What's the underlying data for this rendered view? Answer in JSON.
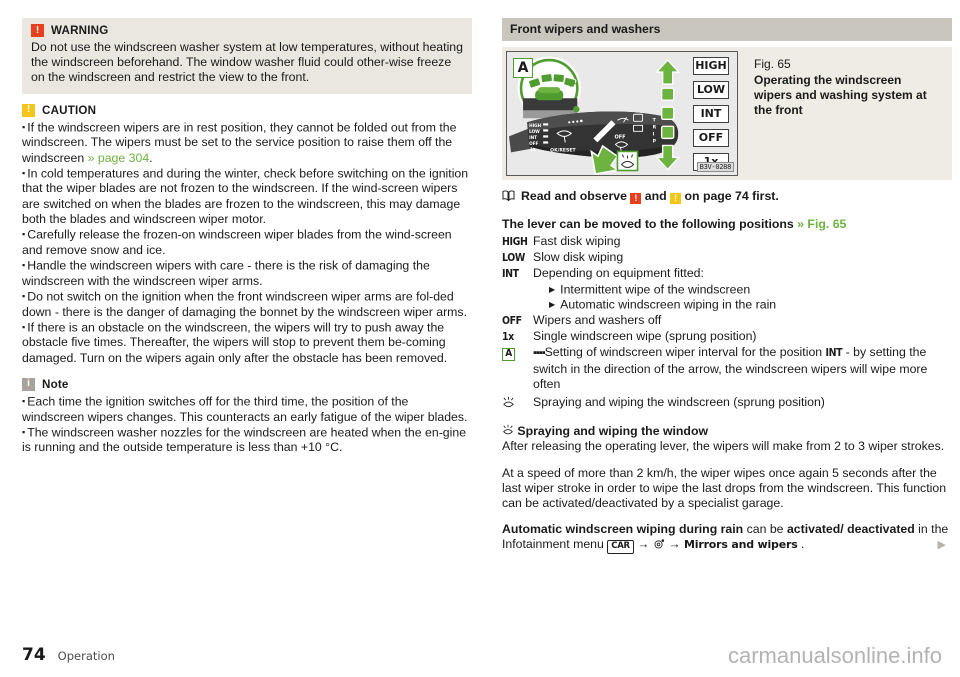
{
  "left": {
    "warning": {
      "badge": "!",
      "title": "WARNING",
      "text": "Do not use the windscreen washer system at low temperatures, without heating the windscreen beforehand. The window washer fluid could other-wise freeze on the windscreen and restrict the view to the front."
    },
    "caution": {
      "badge": "!",
      "title": "CAUTION",
      "bullets": [
        {
          "text_before": "If the windscreen wipers are in rest position, they cannot be folded out from the windscreen. The wipers must be set to the service position to raise them off the windscreen ",
          "xref": "» page 304",
          "text_after": "."
        },
        {
          "text_before": "In cold temperatures and during the winter, check before switching on the ignition that the wiper blades are not frozen to the windscreen. If the wind-screen wipers are switched on when the blades are frozen to the windscreen, this may damage both the blades and windscreen wiper motor.",
          "xref": "",
          "text_after": ""
        },
        {
          "text_before": "Carefully release the frozen-on windscreen wiper blades from the wind-screen and remove snow and ice.",
          "xref": "",
          "text_after": ""
        },
        {
          "text_before": "Handle the windscreen wipers with care - there is the risk of damaging the windscreen with the windscreen wiper arms.",
          "xref": "",
          "text_after": ""
        },
        {
          "text_before": "Do not switch on the ignition when the front windscreen wiper arms are fol-ded down - there is the danger of damaging the bonnet by the windscreen wiper arms.",
          "xref": "",
          "text_after": ""
        },
        {
          "text_before": "If there is an obstacle on the windscreen, the wipers will try to push away the obstacle five times. Thereafter, the wipers will stop to prevent them be-coming damaged. Turn on the wipers again only after the obstacle has been removed.",
          "xref": "",
          "text_after": ""
        }
      ]
    },
    "note": {
      "badge": "i",
      "title": "Note",
      "bullets": [
        {
          "text_before": "Each time the ignition switches off for the third time, the position of the windscreen wipers changes. This counteracts an early fatigue of the wiper blades.",
          "xref": "",
          "text_after": ""
        },
        {
          "text_before": "The windscreen washer nozzles for the windscreen are heated when the en-gine is running and the outside temperature is less than +10 °C.",
          "xref": "",
          "text_after": ""
        }
      ]
    }
  },
  "right": {
    "section_title": "Front wipers and washers",
    "figure": {
      "number": "Fig. 65",
      "description": "Operating the windscreen wipers and washing system at the front",
      "image_id": "B3V-0288",
      "callout_a": "A",
      "chips": [
        "HIGH",
        "LOW",
        "INT",
        "OFF",
        "1x"
      ],
      "lever_scale_labels": [
        "HIGH",
        "LOW",
        "INT",
        "OFF",
        "1x"
      ],
      "lever_text_ok": "OK/RESET",
      "lever_text_trip": "TRIP",
      "lever_text_off": "OFF"
    },
    "read_observe": {
      "prefix": "Read and observe",
      "and": "and",
      "suffix": "on page 74 first.",
      "warn_badge": "!",
      "caution_badge": "!"
    },
    "lever_heading": {
      "text": "The lever can be moved to the following positions",
      "xref": "» Fig. 65"
    },
    "positions": [
      {
        "term": "HIGH",
        "term_type": "mono",
        "desc": "Fast disk wiping",
        "sub": []
      },
      {
        "term": "LOW",
        "term_type": "mono",
        "desc": "Slow disk wiping",
        "sub": []
      },
      {
        "term": "INT",
        "term_type": "mono",
        "desc": "Depending on equipment fitted:",
        "sub": [
          "Intermittent wipe of the windscreen",
          "Automatic windscreen wiping in the rain"
        ]
      },
      {
        "term": "OFF",
        "term_type": "mono",
        "desc": "Wipers and washers off",
        "sub": []
      },
      {
        "term": "1x",
        "term_type": "mono",
        "desc": "Single windscreen wipe (sprung position)",
        "sub": []
      },
      {
        "term": "A",
        "term_type": "box",
        "desc_pre": "Setting of windscreen wiper interval for the position ",
        "desc_mono": "INT",
        "desc_post": " - by setting the switch in the direction of the arrow, the windscreen wipers will wipe more often",
        "sub": []
      },
      {
        "term": "wiper-spray",
        "term_type": "icon",
        "desc": "Spraying and wiping the windscreen (sprung position)",
        "sub": []
      }
    ],
    "spray_section": {
      "heading": "Spraying and wiping the window",
      "para1": "After releasing the operating lever, the wipers will make from 2 to 3 wiper strokes.",
      "para2": "At a speed of more than 2 km/h, the wiper wipes once again 5 seconds after the last wiper stroke in order to wipe the last drops from the windscreen. This function can be activated/deactivated by a specialist garage."
    },
    "auto_rain": {
      "bold1": "Automatic windscreen wiping during rain",
      "mid": " can be ",
      "bold2": "activated/ deactivated",
      "tail": " in the Infotainment menu ",
      "chip": "CAR",
      "arrow": "→",
      "setup_icon": "gear-icon",
      "menu_item": "Mirrors and wipers",
      "period": "."
    },
    "next_page_arrow": "▶"
  },
  "footer": {
    "page_number": "74",
    "chapter": "Operation",
    "watermark": "carmanualsonline.info"
  },
  "colors": {
    "accent_green": "#6cb33f",
    "warning_red": "#e8401f",
    "caution_yellow": "#f5c518",
    "note_grey": "#a8a29a",
    "box_bg": "#e9e7e0",
    "section_bg": "#c9c6bd",
    "figure_bg": "#efece5"
  }
}
